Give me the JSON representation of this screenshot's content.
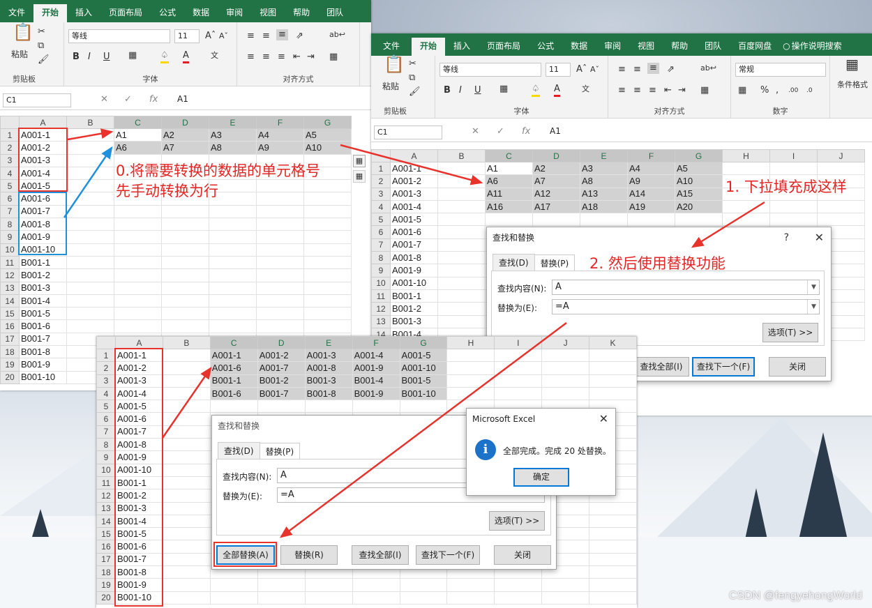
{
  "win1": {
    "tabs": [
      "文件",
      "开始",
      "插入",
      "页面布局",
      "公式",
      "数据",
      "审阅",
      "视图",
      "帮助",
      "团队"
    ],
    "font_name": "等线",
    "font_size": "11",
    "group_clipboard": "剪贴板",
    "group_font": "字体",
    "group_align": "对齐方式",
    "paste_label": "粘贴",
    "bold": "B",
    "italic": "I",
    "underline": "U",
    "cell_ref": "C1",
    "formula": "A1",
    "cols": [
      "A",
      "B",
      "C",
      "D",
      "E",
      "F",
      "G"
    ],
    "rows": [
      [
        "A001-1",
        "",
        "A1",
        "A2",
        "A3",
        "A4",
        "A5"
      ],
      [
        "A001-2",
        "",
        "A6",
        "A7",
        "A8",
        "A9",
        "A10"
      ],
      [
        "A001-3",
        "",
        "",
        "",
        "",
        "",
        ""
      ],
      [
        "A001-4",
        "",
        "",
        "",
        "",
        "",
        ""
      ],
      [
        "A001-5",
        "",
        "",
        "",
        "",
        "",
        ""
      ],
      [
        "A001-6",
        "",
        "",
        "",
        "",
        "",
        ""
      ],
      [
        "A001-7",
        "",
        "",
        "",
        "",
        "",
        ""
      ],
      [
        "A001-8",
        "",
        "",
        "",
        "",
        "",
        ""
      ],
      [
        "A001-9",
        "",
        "",
        "",
        "",
        "",
        ""
      ],
      [
        "A001-10",
        "",
        "",
        "",
        "",
        "",
        ""
      ],
      [
        "B001-1",
        "",
        "",
        "",
        "",
        "",
        ""
      ],
      [
        "B001-2",
        "",
        "",
        "",
        "",
        "",
        ""
      ],
      [
        "B001-3",
        "",
        "",
        "",
        "",
        "",
        ""
      ],
      [
        "B001-4",
        "",
        "",
        "",
        "",
        "",
        ""
      ],
      [
        "B001-5",
        "",
        "",
        "",
        "",
        "",
        ""
      ],
      [
        "B001-6",
        "",
        "",
        "",
        "",
        "",
        ""
      ],
      [
        "B001-7",
        "",
        "",
        "",
        "",
        "",
        ""
      ],
      [
        "B001-8",
        "",
        "",
        "",
        "",
        "",
        ""
      ],
      [
        "B001-9",
        "",
        "",
        "",
        "",
        "",
        ""
      ],
      [
        "B001-10",
        "",
        "",
        "",
        "",
        "",
        ""
      ]
    ]
  },
  "win2": {
    "tabs": [
      "文件",
      "开始",
      "插入",
      "页面布局",
      "公式",
      "数据",
      "审阅",
      "视图",
      "帮助",
      "团队",
      "百度网盘",
      "操作说明搜索"
    ],
    "font_name": "等线",
    "font_size": "11",
    "number_format": "常规",
    "group_clipboard": "剪贴板",
    "group_font": "字体",
    "group_align": "对齐方式",
    "group_number": "数字",
    "paste_label": "粘贴",
    "cond_format": "条件格式",
    "cell_ref": "C1",
    "formula": "A1",
    "cols": [
      "A",
      "B",
      "C",
      "D",
      "E",
      "F",
      "G",
      "H",
      "I",
      "J"
    ],
    "rows": [
      [
        "A001-1",
        "",
        "A1",
        "A2",
        "A3",
        "A4",
        "A5"
      ],
      [
        "A001-2",
        "",
        "A6",
        "A7",
        "A8",
        "A9",
        "A10"
      ],
      [
        "A001-3",
        "",
        "A11",
        "A12",
        "A13",
        "A14",
        "A15"
      ],
      [
        "A001-4",
        "",
        "A16",
        "A17",
        "A18",
        "A19",
        "A20"
      ],
      [
        "A001-5",
        "",
        "",
        "",
        "",
        "",
        ""
      ],
      [
        "A001-6",
        "",
        "",
        "",
        "",
        "",
        ""
      ],
      [
        "A001-7",
        "",
        "",
        "",
        "",
        "",
        ""
      ],
      [
        "A001-8",
        "",
        "",
        "",
        "",
        "",
        ""
      ],
      [
        "A001-9",
        "",
        "",
        "",
        "",
        "",
        ""
      ],
      [
        "A001-10",
        "",
        "",
        "",
        "",
        "",
        ""
      ],
      [
        "B001-1",
        "",
        "",
        "",
        "",
        "",
        ""
      ],
      [
        "B001-2",
        "",
        "",
        "",
        "",
        "",
        ""
      ],
      [
        "B001-3",
        "",
        "",
        "",
        "",
        "",
        ""
      ],
      [
        "B001-4",
        "",
        "",
        "",
        "",
        "",
        ""
      ]
    ]
  },
  "dialog2": {
    "title": "查找和替换",
    "help": "?",
    "tab_find": "查找(D)",
    "tab_replace": "替换(P)",
    "find_label": "查找内容(N):",
    "find_value": "A",
    "replace_label": "替换为(E):",
    "replace_value": "=A",
    "options": "选项(T) >>",
    "find_all": "查找全部(I)",
    "find_next": "查找下一个(F)",
    "close": "关闭"
  },
  "win3": {
    "cols": [
      "A",
      "B",
      "C",
      "D",
      "E",
      "F",
      "G",
      "H",
      "I",
      "J",
      "K"
    ],
    "rows": [
      [
        "A001-1",
        "",
        "A001-1",
        "A001-2",
        "A001-3",
        "A001-4",
        "A001-5"
      ],
      [
        "A001-2",
        "",
        "A001-6",
        "A001-7",
        "A001-8",
        "A001-9",
        "A001-10"
      ],
      [
        "A001-3",
        "",
        "B001-1",
        "B001-2",
        "B001-3",
        "B001-4",
        "B001-5"
      ],
      [
        "A001-4",
        "",
        "B001-6",
        "B001-7",
        "B001-8",
        "B001-9",
        "B001-10"
      ],
      [
        "A001-5",
        "",
        "",
        "",
        "",
        "",
        ""
      ],
      [
        "A001-6",
        "",
        "",
        "",
        "",
        "",
        ""
      ],
      [
        "A001-7",
        "",
        "",
        "",
        "",
        "",
        ""
      ],
      [
        "A001-8",
        "",
        "",
        "",
        "",
        "",
        ""
      ],
      [
        "A001-9",
        "",
        "",
        "",
        "",
        "",
        ""
      ],
      [
        "A001-10",
        "",
        "",
        "",
        "",
        "",
        ""
      ],
      [
        "B001-1",
        "",
        "",
        "",
        "",
        "",
        ""
      ],
      [
        "B001-2",
        "",
        "",
        "",
        "",
        "",
        ""
      ],
      [
        "B001-3",
        "",
        "",
        "",
        "",
        "",
        ""
      ],
      [
        "B001-4",
        "",
        "",
        "",
        "",
        "",
        ""
      ],
      [
        "B001-5",
        "",
        "",
        "",
        "",
        "",
        ""
      ],
      [
        "B001-6",
        "",
        "",
        "",
        "",
        "",
        ""
      ],
      [
        "B001-7",
        "",
        "",
        "",
        "",
        "",
        ""
      ],
      [
        "B001-8",
        "",
        "",
        "",
        "",
        "",
        ""
      ],
      [
        "B001-9",
        "",
        "",
        "",
        "",
        "",
        ""
      ],
      [
        "B001-10",
        "",
        "",
        "",
        "",
        "",
        ""
      ]
    ]
  },
  "dialog3": {
    "title": "查找和替换",
    "tab_find": "查找(D)",
    "tab_replace": "替换(P)",
    "find_label": "查找内容(N):",
    "find_value": "A",
    "replace_label": "替换为(E):",
    "replace_value": "=A",
    "options": "选项(T) >>",
    "replace_all": "全部替换(A)",
    "replace": "替换(R)",
    "find_all": "查找全部(I)",
    "find_next": "查找下一个(F)",
    "close": "关闭"
  },
  "msgbox": {
    "title": "Microsoft Excel",
    "message": "全部完成。完成 20 处替换。",
    "ok": "确定"
  },
  "annotations": {
    "step0_line1": "0.将需要转换的数据的单元格号",
    "step0_line2": "先手动转换为行",
    "step1": "1. 下拉填充成这样",
    "step2": "2. 然后使用替换功能"
  },
  "watermark": "CSDN @fengyehongWorld",
  "colors": {
    "excel_green": "#217346",
    "annotation_red": "#e32626",
    "annotation_blue": "#1e90dc"
  }
}
